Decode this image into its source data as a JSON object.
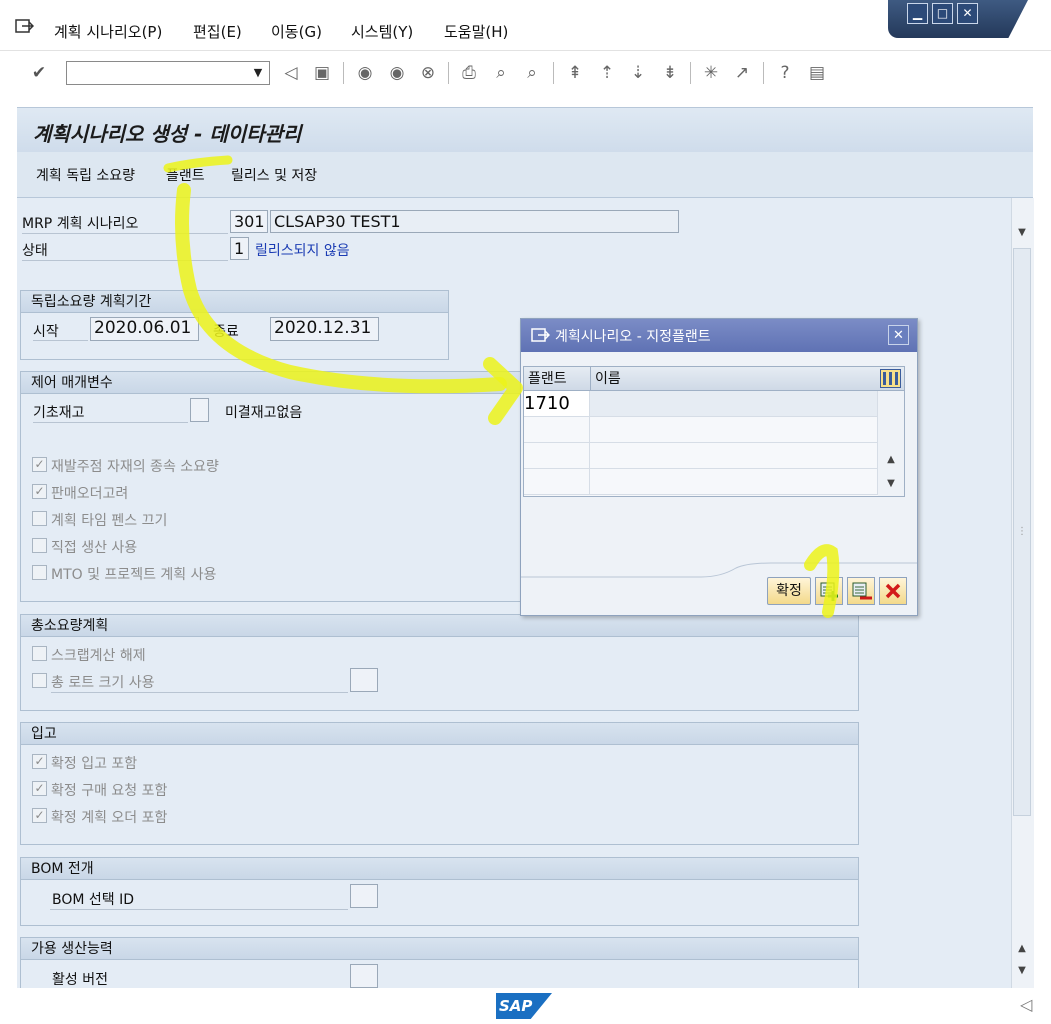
{
  "menu": {
    "items": [
      "계획 시나리오(P)",
      "편집(E)",
      "이동(G)",
      "시스템(Y)",
      "도움말(H)"
    ]
  },
  "toolbar": {
    "command_value": ""
  },
  "title": "계획시나리오 생성 - 데이타관리",
  "app_toolbar": {
    "items": [
      "계획 독립 소요량",
      "플랜트",
      "릴리스 및 저장"
    ]
  },
  "header": {
    "scenario_label": "MRP 계획 시나리오",
    "scenario_id": "301",
    "scenario_name": "CLSAP30 TEST1",
    "status_label": "상태",
    "status_code": "1",
    "status_text": "릴리스되지 않음"
  },
  "period": {
    "title": "독립소요량 계획기간",
    "start_label": "시작",
    "start_value": "2020.06.01",
    "end_label": "종료",
    "end_value": "2020.12.31"
  },
  "control": {
    "title": "제어 매개변수",
    "basic_stock_label": "기초재고",
    "no_open_stock_label": "미결재고없음",
    "options": [
      {
        "label": "재발주점 자재의 종속 소요량",
        "checked": true
      },
      {
        "label": "판매오더고려",
        "checked": true
      },
      {
        "label": "계획 타임 펜스 끄기",
        "checked": false
      },
      {
        "label": "직접 생산 사용",
        "checked": false
      },
      {
        "label": "MTO 및 프로젝트 계획 사용",
        "checked": false
      }
    ]
  },
  "gross": {
    "title": "총소요량계획",
    "options": [
      {
        "label": "스크랩계산 해제",
        "checked": false
      },
      {
        "label": "총 로트 크기 사용",
        "checked": false
      }
    ]
  },
  "receipts": {
    "title": "입고",
    "options": [
      {
        "label": "확정 입고 포함",
        "checked": true
      },
      {
        "label": "확정 구매 요청 포함",
        "checked": true
      },
      {
        "label": "확정 계획 오더 포함",
        "checked": true
      }
    ]
  },
  "bom": {
    "title": "BOM 전개",
    "select_id_label": "BOM 선택 ID"
  },
  "capacity": {
    "title": "가용 생산능력",
    "active_version_label": "활성 버전"
  },
  "dialog": {
    "title": "계획시나리오 - 지정플랜트",
    "columns": [
      "플랜트",
      "이름"
    ],
    "rows": [
      {
        "plant": "1710",
        "name": ""
      },
      {
        "plant": "",
        "name": ""
      },
      {
        "plant": "",
        "name": ""
      },
      {
        "plant": "",
        "name": ""
      }
    ],
    "confirm_label": "확정"
  },
  "status_bar": {
    "logo_text": "SAP"
  }
}
